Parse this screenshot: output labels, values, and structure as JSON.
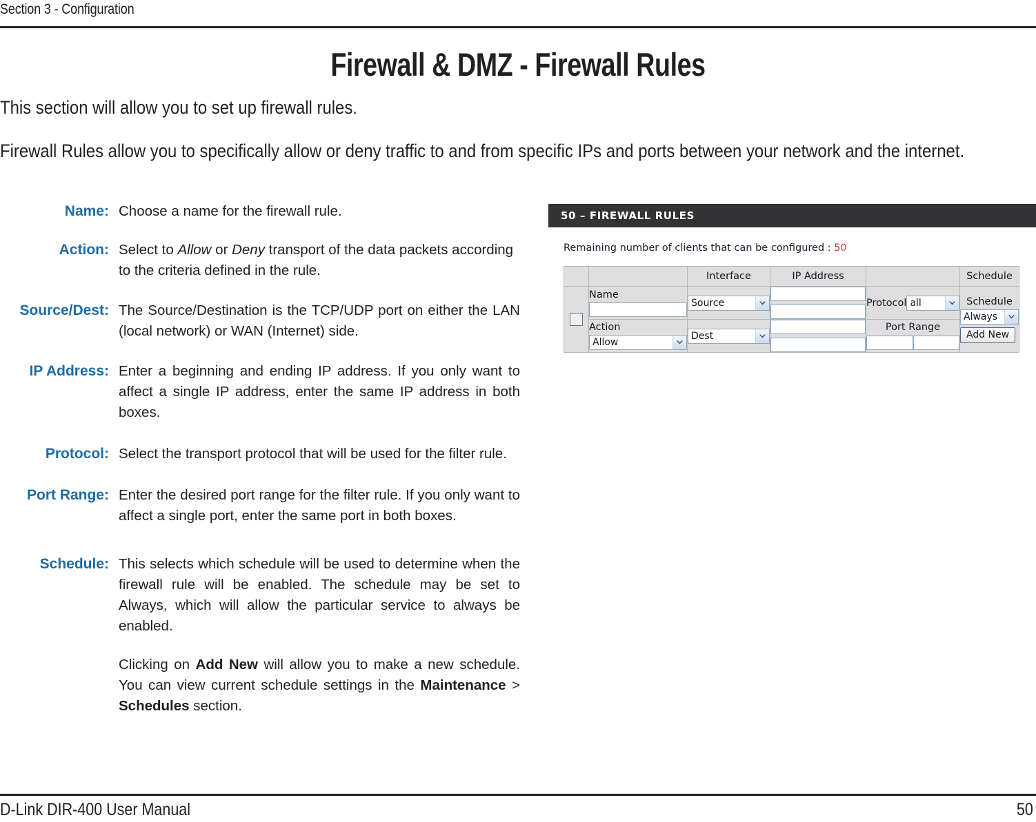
{
  "header": {
    "section_label": "Section 3 - Configuration"
  },
  "title": "Firewall & DMZ - Firewall Rules",
  "intro": {
    "paragraph1": "This section will allow you to set up firewall rules.",
    "paragraph2": "Firewall Rules allow you to specifically allow or deny traffic to and from specific IPs and ports between your network and the internet."
  },
  "descriptions": [
    {
      "term": "Name:",
      "text": "Choose a name for the firewall rule."
    },
    {
      "term": "Action:",
      "text_parts": {
        "a": "Select to ",
        "i1": "Allow",
        "b": " or ",
        "i2": "Deny",
        "c": " transport of the data packets according to the criteria defined in the rule."
      }
    },
    {
      "term": "Source/Dest:",
      "text": "The Source/Destination is the TCP/UDP port on either the LAN (local network) or WAN (Internet) side."
    },
    {
      "term": "IP Address:",
      "text": "Enter a beginning and ending IP address. If you only want to affect a single IP address, enter the same IP address in both boxes."
    },
    {
      "term": "Protocol:",
      "text": "Select the transport protocol that will be used for the filter rule."
    },
    {
      "term": "Port Range:",
      "text": "Enter the desired port range for the filter rule. If you only want to affect a single port, enter the same port in both boxes."
    },
    {
      "term": "Schedule:",
      "text": "This selects which schedule will be used to determine when the firewall rule will be enabled. The schedule may be set to Always, which will allow the particular service to always be enabled.",
      "sub_parts": {
        "a": "Clicking on ",
        "b1": "Add New",
        "b": " will allow you to make a new schedule.  You can view current schedule settings in the ",
        "b2": "Maintenance",
        "c": " > ",
        "b3": "Schedules",
        "d": " section."
      }
    }
  ],
  "panel": {
    "titlebar": "50 – FIREWALL RULES",
    "remaining_text": "Remaining number of clients that can be configured : ",
    "remaining_count": "50",
    "columns": [
      "",
      "",
      "Interface",
      "IP Address",
      "",
      "Schedule"
    ],
    "fields": {
      "name_label": "Name",
      "name_value": "",
      "action_label": "Action",
      "action_value": "Allow",
      "interface_source": "Source",
      "interface_dest": "Dest",
      "ip_start_1": "",
      "ip_end_1": "",
      "ip_start_2": "",
      "ip_end_2": "",
      "protocol_label": "Protocol",
      "protocol_value": "all",
      "port_range_label": "Port Range",
      "port_start": "",
      "port_end": "",
      "schedule_label": "Schedule",
      "schedule_value": "Always",
      "add_new_label": "Add New"
    }
  },
  "footer": {
    "left": "D-Link DIR-400 User Manual",
    "page_number": "50"
  },
  "colors": {
    "term_blue": "#1c6ca4",
    "titlebar_dark": "#333234",
    "accent_red": "#e8312f",
    "ink": "#231f20"
  }
}
